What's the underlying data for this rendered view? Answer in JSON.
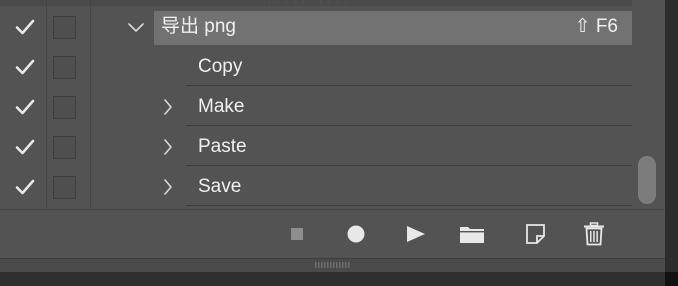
{
  "actions": [
    {
      "label": "导出 png",
      "shortcut": "⇧ F6",
      "expanded": true,
      "checked": true,
      "selected": true,
      "indent": 0,
      "has_expander": true
    },
    {
      "label": "Copy",
      "shortcut": "",
      "expanded": false,
      "checked": true,
      "selected": false,
      "indent": 1,
      "has_expander": false
    },
    {
      "label": "Make",
      "shortcut": "",
      "expanded": false,
      "checked": true,
      "selected": false,
      "indent": 1,
      "has_expander": true
    },
    {
      "label": "Paste",
      "shortcut": "",
      "expanded": false,
      "checked": true,
      "selected": false,
      "indent": 1,
      "has_expander": true
    },
    {
      "label": "Save",
      "shortcut": "",
      "expanded": false,
      "checked": true,
      "selected": false,
      "indent": 1,
      "has_expander": true
    }
  ],
  "toolbar": {
    "buttons": [
      {
        "name": "stop-recording-button",
        "icon": "stop-icon"
      },
      {
        "name": "begin-recording-button",
        "icon": "record-icon"
      },
      {
        "name": "play-selection-button",
        "icon": "play-icon"
      },
      {
        "name": "create-new-set-button",
        "icon": "folder-icon"
      },
      {
        "name": "create-new-action-button",
        "icon": "new-item-icon"
      },
      {
        "name": "delete-button",
        "icon": "trash-icon"
      }
    ]
  },
  "colors": {
    "panel_bg": "#535353",
    "selected_row": "#727272",
    "text": "#f0f0f0",
    "icon": "#e8e8e8",
    "icon_dim": "#9a9a9a"
  }
}
